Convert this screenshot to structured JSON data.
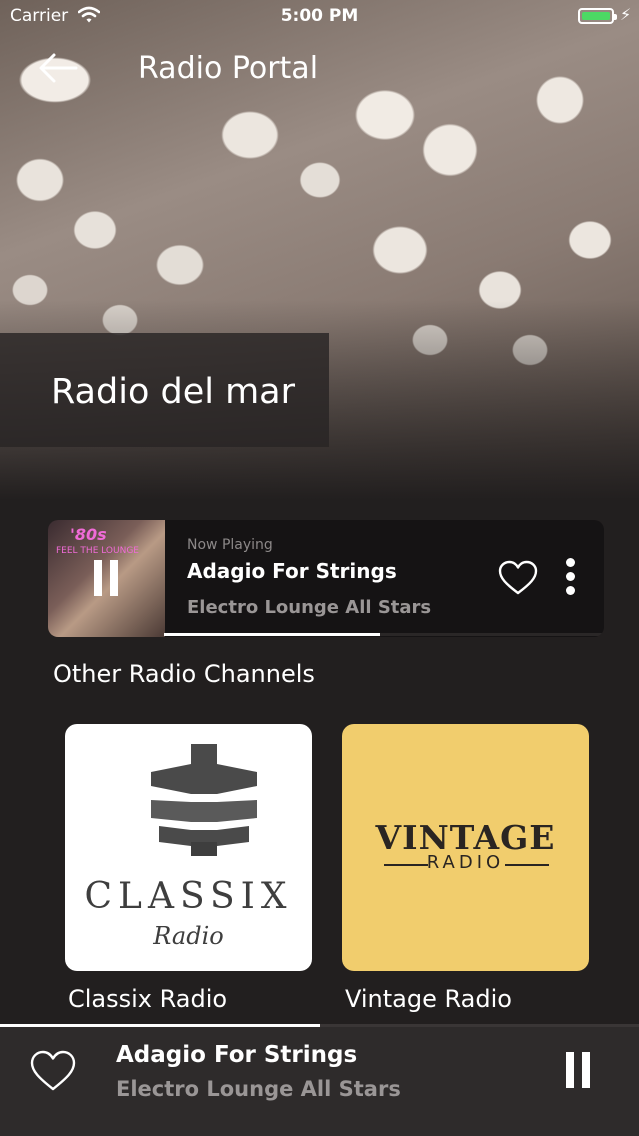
{
  "status_bar": {
    "carrier": "Carrier",
    "time": "5:00 PM",
    "icons": [
      "wifi-icon",
      "battery-icon",
      "charging-icon"
    ],
    "battery_color": "#4cd964"
  },
  "nav": {
    "title": "Radio Portal",
    "back_icon": "arrow-left-icon"
  },
  "station": {
    "name": "Radio del mar"
  },
  "now_playing": {
    "label": "Now Playing",
    "song": "Adagio For Strings",
    "artist": "Electro Lounge All Stars",
    "album_art_title": "'80s",
    "album_art_subtitle": "FEEL THE LOUNGE",
    "progress": 0.49,
    "icons": [
      "pause-icon",
      "heart-outline-icon",
      "more-vertical-icon"
    ]
  },
  "channels_section": {
    "title": "Other Radio Channels",
    "channels": [
      {
        "name": "Classix Radio",
        "logo_word": "CLASSIX",
        "logo_sub": "Radio",
        "bg": "#ffffff"
      },
      {
        "name": "Vintage Radio",
        "logo_word": "VINTAGE",
        "logo_sub": "RADIO",
        "bg": "#f1cd6d"
      }
    ]
  },
  "player": {
    "song": "Adagio For Strings",
    "artist": "Electro Lounge All Stars",
    "progress": 0.5,
    "icons": [
      "heart-outline-icon",
      "pause-icon"
    ]
  },
  "colors": {
    "background": "#221f1f",
    "card": "#151314",
    "player_bar": "#2e2b2b",
    "muted_text": "#9a9696"
  }
}
